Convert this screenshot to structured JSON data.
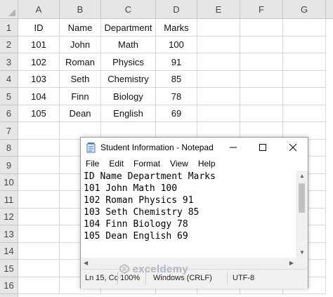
{
  "columns": [
    "A",
    "B",
    "C",
    "D",
    "E",
    "F",
    "G"
  ],
  "rows": [
    "1",
    "2",
    "3",
    "4",
    "5",
    "6",
    "7",
    "8",
    "9",
    "10",
    "11",
    "12",
    "13",
    "14",
    "15",
    "16"
  ],
  "table": [
    [
      "ID",
      "Name",
      "Department",
      "Marks"
    ],
    [
      "101",
      "John",
      "Math",
      "100"
    ],
    [
      "102",
      "Roman",
      "Physics",
      "91"
    ],
    [
      "103",
      "Seth",
      "Chemistry",
      "85"
    ],
    [
      "104",
      "Finn",
      "Biology",
      "78"
    ],
    [
      "105",
      "Dean",
      "English",
      "69"
    ]
  ],
  "notepad": {
    "title": "Student Information - Notepad",
    "menu": [
      "File",
      "Edit",
      "Format",
      "View",
      "Help"
    ],
    "lines": [
      "ID Name Department Marks",
      "101 John Math 100",
      "102 Roman Physics 91",
      "103 Seth Chemistry 85",
      "104 Finn Biology 78",
      "105 Dean English 69"
    ],
    "status": {
      "position": "Ln 15, Co",
      "zoom": "100%",
      "line_ending": "Windows (CRLF)",
      "encoding": "UTF-8"
    }
  },
  "watermark": "exceldemy"
}
